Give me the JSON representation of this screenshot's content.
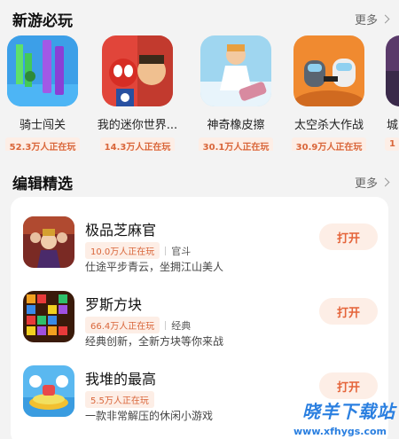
{
  "new_games": {
    "title": "新游必玩",
    "more_label": "更多",
    "items": [
      {
        "name": "骑士闯关",
        "players": "52.3万人正在玩"
      },
      {
        "name": "我的迷你世界...",
        "players": "14.3万人正在玩"
      },
      {
        "name": "神奇橡皮擦",
        "players": "30.1万人正在玩"
      },
      {
        "name": "太空杀大作战",
        "players": "30.9万人正在玩"
      },
      {
        "name": "城",
        "players": "1"
      }
    ]
  },
  "editor_picks": {
    "title": "编辑精选",
    "more_label": "更多",
    "open_label": "打开",
    "items": [
      {
        "name": "极品芝麻官",
        "players": "10.0万人正在玩",
        "category": "官斗",
        "desc": "仕途平步青云，坐拥江山美人"
      },
      {
        "name": "罗斯方块",
        "players": "66.4万人正在玩",
        "category": "经典",
        "desc": "经典创新，全新方块等你来战"
      },
      {
        "name": "我堆的最高",
        "players": "5.5万人正在玩",
        "category": "",
        "desc": "一款非常解压的休闲小游戏"
      }
    ]
  },
  "watermark": {
    "text": "晓羊下载站",
    "url": "www.xfhygs.com"
  },
  "colors": {
    "accent": "#e5643a",
    "badge_bg": "#fdeee6"
  }
}
